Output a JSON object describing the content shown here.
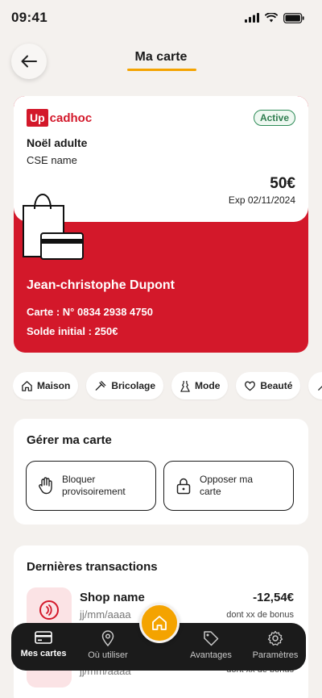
{
  "status_bar": {
    "time": "09:41"
  },
  "header": {
    "title": "Ma carte"
  },
  "card": {
    "logo_up": "Up",
    "logo_rest": "cadhoc",
    "status": "Active",
    "name": "Noël adulte",
    "cse": "CSE name",
    "amount": "50€",
    "expiry": "Exp 02/11/2024",
    "holder": "Jean-christophe Dupont",
    "number": "Carte : N° 0834 2938 4750",
    "initial_balance": "Solde initial : 250€"
  },
  "categories": [
    {
      "label": "Maison",
      "icon": "house-icon"
    },
    {
      "label": "Bricolage",
      "icon": "tools-icon"
    },
    {
      "label": "Mode",
      "icon": "dress-icon"
    },
    {
      "label": "Beauté",
      "icon": "heart-icon"
    }
  ],
  "manage": {
    "title": "Gérer ma carte",
    "block_line1": "Bloquer",
    "block_line2": "provisoirement",
    "oppose_line1": "Opposer ma",
    "oppose_line2": "carte"
  },
  "transactions": {
    "title": "Dernières transactions",
    "items": [
      {
        "name": "Shop name",
        "date": "jj/mm/aaaa",
        "amount": "-12,54€",
        "bonus": "dont xx de bonus"
      },
      {
        "name": "",
        "date": "jj/mm/aaaa",
        "amount": "",
        "bonus": "dont xx de bonus"
      }
    ]
  },
  "bottom_nav": {
    "items": [
      {
        "label": "Mes cartes",
        "icon": "card-icon"
      },
      {
        "label": "Où utiliser",
        "icon": "map-pin-icon"
      },
      {
        "label": "Avantages",
        "icon": "tag-icon"
      },
      {
        "label": "Paramètres",
        "icon": "gear-icon"
      }
    ],
    "home_icon": "home-icon"
  },
  "colors": {
    "brand_red": "#d3182a",
    "accent_orange": "#f4a300",
    "background": "#f4f1ee",
    "active_green": "#2e8b57",
    "nav_dark": "#1b1b1b"
  }
}
